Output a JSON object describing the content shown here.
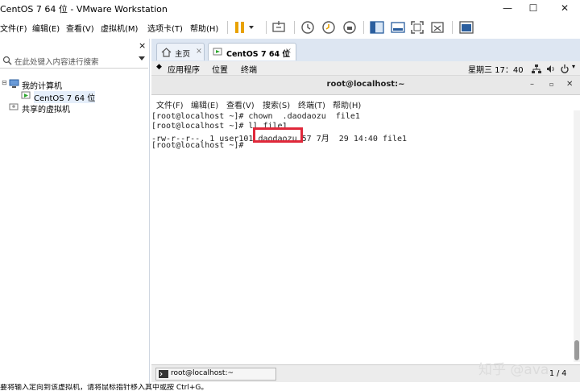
{
  "window": {
    "title": "CentOS 7 64 位 - VMware Workstation",
    "controls": [
      "—",
      "☐",
      "✕"
    ]
  },
  "menubar": {
    "items": [
      "文件(F)",
      "编辑(E)",
      "查看(V)",
      "虚拟机(M)",
      "选项卡(T)",
      "帮助(H)"
    ]
  },
  "library": {
    "close": "×",
    "search_placeholder": "在此处键入内容进行搜索",
    "tree": {
      "root": "我的计算机",
      "vm": "CentOS 7 64 位",
      "shared": "共享的虚拟机"
    }
  },
  "tabs": [
    {
      "label": "主页",
      "close": "×"
    },
    {
      "label": "CentOS 7 64 位",
      "close": "×"
    }
  ],
  "gnome_bar": {
    "apps": "应用程序",
    "places": "位置",
    "terminal": "终端",
    "clock": "星期三 17：40"
  },
  "terminal_window": {
    "title": "root@localhost:~",
    "controls": [
      "–",
      "▫",
      "✕"
    ],
    "menu": [
      "文件(F)",
      "编辑(E)",
      "查看(V)",
      "搜索(S)",
      "终端(T)",
      "帮助(H)"
    ],
    "lines": [
      "[root@localhost ~]# chown  .daodaozu  file1",
      "[root@localhost ~]# ll file1",
      "-rw-r--r--. 1 user101 daodaozu 57 7月  29 14:40 file1",
      "[root@localhost ~]# "
    ],
    "highlight_text": "daodaozu"
  },
  "taskbar": {
    "item": "root@localhost:~",
    "pager": "1 / 4"
  },
  "watermark": "知乎 @ava",
  "statusbar": {
    "text": "要将输入定向到该虚拟机，请将鼠标指针移入其中或按 Ctrl+G。"
  },
  "colors": {
    "highlight_box": "#e0283a",
    "tab_strip": "#dde6f2",
    "pause_icon": "#e8a200"
  }
}
